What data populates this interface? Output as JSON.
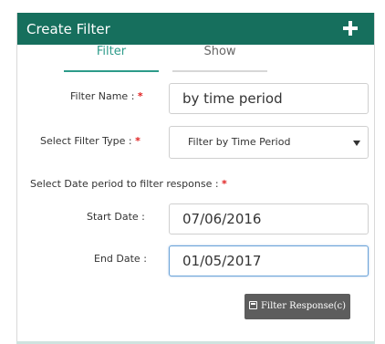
{
  "panel": {
    "title": "Create Filter",
    "add_icon": "plus-icon",
    "header_color": "#166f5d"
  },
  "tabs": [
    {
      "label": "Filter",
      "active": true
    },
    {
      "label": "Show",
      "active": false
    }
  ],
  "form": {
    "filter_name": {
      "label": "Filter Name :",
      "required": "*",
      "value": "by time period"
    },
    "filter_type": {
      "label": "Select Filter Type :",
      "required": "*",
      "value": "Filter by Time Period"
    },
    "date_period": {
      "label": "Select Date period to filter response :",
      "required": "*"
    },
    "start_date": {
      "label": "Start Date :",
      "value": "07/06/2016"
    },
    "end_date": {
      "label": "End Date :",
      "value": "01/05/2017"
    }
  },
  "submit": {
    "label": "Filter Response(c)",
    "icon": "save-icon"
  },
  "colors": {
    "accent": "#2d9b8a",
    "required": "#e02020",
    "button": "#5d5d5d"
  }
}
